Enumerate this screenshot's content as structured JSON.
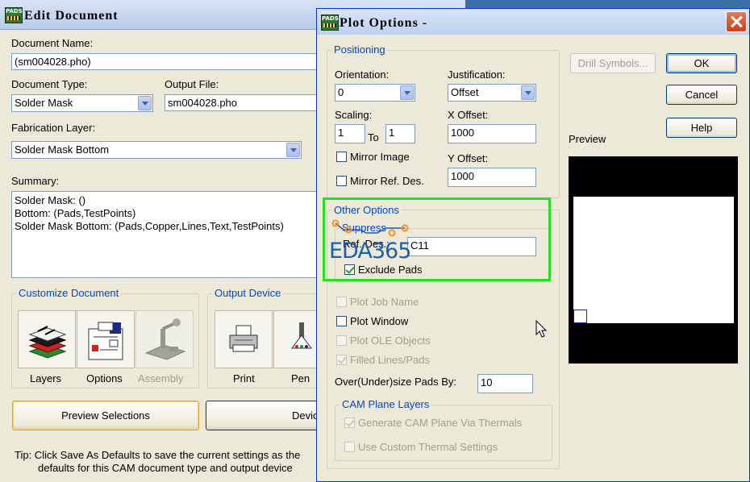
{
  "edit_document": {
    "title": "Edit Document",
    "document_name_label": "Document Name:",
    "document_name_value": "(sm004028.pho)",
    "document_type_label": "Document Type:",
    "document_type_value": "Solder Mask",
    "output_file_label": "Output File:",
    "output_file_value": "sm004028.pho",
    "fabrication_layer_label": "Fabrication Layer:",
    "fabrication_layer_value": "Solder Mask Bottom",
    "summary_label": "Summary:",
    "summary_lines": [
      "Solder Mask: ()",
      "Bottom: (Pads,TestPoints)",
      "Solder Mask Bottom: (Pads,Copper,Lines,Text,TestPoints)"
    ],
    "customize_group_label": "Customize Document",
    "customize_buttons": [
      "Layers",
      "Options",
      "Assembly"
    ],
    "output_device_group_label": "Output Device",
    "output_device_buttons": [
      "Print",
      "Pen"
    ],
    "preview_selections_button": "Preview Selections",
    "device_button_partial": "Devic",
    "tip_line1": "Tip:  Click Save As Defaults to save the current settings as the",
    "tip_line2": "defaults for this CAM document type and output device"
  },
  "plot_options": {
    "title": "Plot Options  -",
    "positioning_group_label": "Positioning",
    "orientation_label": "Orientation:",
    "orientation_value": "0",
    "justification_label": "Justification:",
    "justification_value": "Offset",
    "scaling_label": "Scaling:",
    "scaling_from": "1",
    "scaling_to_label": "To",
    "scaling_to": "1",
    "x_offset_label": "X Offset:",
    "x_offset_value": "1000",
    "y_offset_label": "Y Offset:",
    "y_offset_value": "1000",
    "mirror_image_label": "Mirror Image",
    "mirror_image_checked": false,
    "mirror_ref_des_label": "Mirror Ref. Des.",
    "mirror_ref_des_checked": false,
    "other_options_group_label": "Other Options",
    "suppress_group_label": "Suppress",
    "ref_des_label": "Ref. Des.:",
    "ref_des_value": "C11",
    "exclude_pads_label": "Exclude Pads",
    "exclude_pads_checked": true,
    "plot_job_name_label": "Plot Job Name",
    "plot_window_label": "Plot Window",
    "plot_ole_objects_label": "Plot OLE Objects",
    "filled_lines_pads_label": "Filled Lines/Pads",
    "filled_lines_pads_checked": true,
    "oversize_pads_label": "Over(Under)size Pads By:",
    "oversize_pads_value": "10",
    "cam_plane_group_label": "CAM Plane Layers",
    "generate_cam_plane_label": "Generate CAM Plane Via Thermals",
    "generate_cam_plane_checked": true,
    "use_custom_thermal_label": "Use Custom Thermal Settings",
    "use_custom_thermal_checked": false,
    "drill_symbols_button": "Drill Symbols...",
    "ok_button": "OK",
    "cancel_button": "Cancel",
    "help_button": "Help",
    "preview_label": "Preview"
  },
  "watermark": {
    "text": "EDA365"
  },
  "colors": {
    "highlight_box": "#22e222",
    "group_title": "#0046d5",
    "title_bar": "#c8d7f0",
    "preview_background": "#000000",
    "preview_board": "#ffffff",
    "watermark_blue": "#1b5fae",
    "watermark_orange": "#f7941d"
  }
}
